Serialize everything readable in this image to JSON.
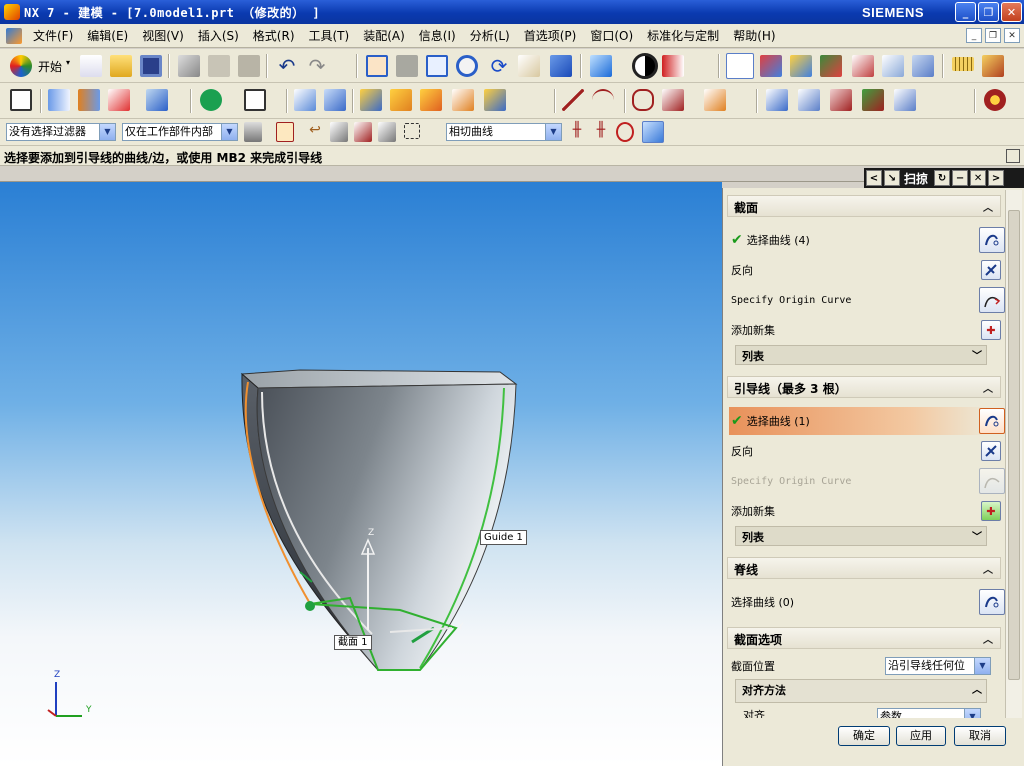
{
  "window": {
    "title": "NX 7 - 建模 - [7.0model1.prt （修改的） ]",
    "brand": "SIEMENS"
  },
  "menu": [
    "文件(F)",
    "编辑(E)",
    "视图(V)",
    "插入(S)",
    "格式(R)",
    "工具(T)",
    "装配(A)",
    "信息(I)",
    "分析(L)",
    "首选项(P)",
    "窗口(O)",
    "标准化与定制",
    "帮助(H)"
  ],
  "toolbar": {
    "start_label": "开始",
    "filter_select": "没有选择过滤器",
    "scope_select": "仅在工作部件内部",
    "curve_rule_select": "相切曲线"
  },
  "prompt": "选择要添加到引导线的曲线/边，或使用 MB2 来完成引导线",
  "panel": {
    "title": "扫掠",
    "sections": {
      "section_title": "截面",
      "section_select": "选择曲线 (4)",
      "section_reverse": "反向",
      "section_origin": "Specify Origin Curve",
      "section_addnew": "添加新集",
      "section_list": "列表",
      "guide_title": "引导线（最多 3 根）",
      "guide_select": "选择曲线 (1)",
      "guide_reverse": "反向",
      "guide_origin": "Specify Origin Curve",
      "guide_addnew": "添加新集",
      "guide_list": "列表",
      "spine_title": "脊线",
      "spine_select": "选择曲线 (0)",
      "options_title": "截面选项",
      "location_label": "截面位置",
      "location_value": "沿引导线任何位",
      "align_title": "对齐方法",
      "align_label": "对齐",
      "align_value": "参数"
    },
    "buttons": {
      "ok": "确定",
      "apply": "应用",
      "cancel": "取消"
    }
  },
  "viewport": {
    "guide_label": "Guide 1",
    "section_label": "截面 1",
    "axis_x": "Y",
    "axis_z": "Z",
    "triad_x": "Y",
    "triad_z": "Z"
  }
}
